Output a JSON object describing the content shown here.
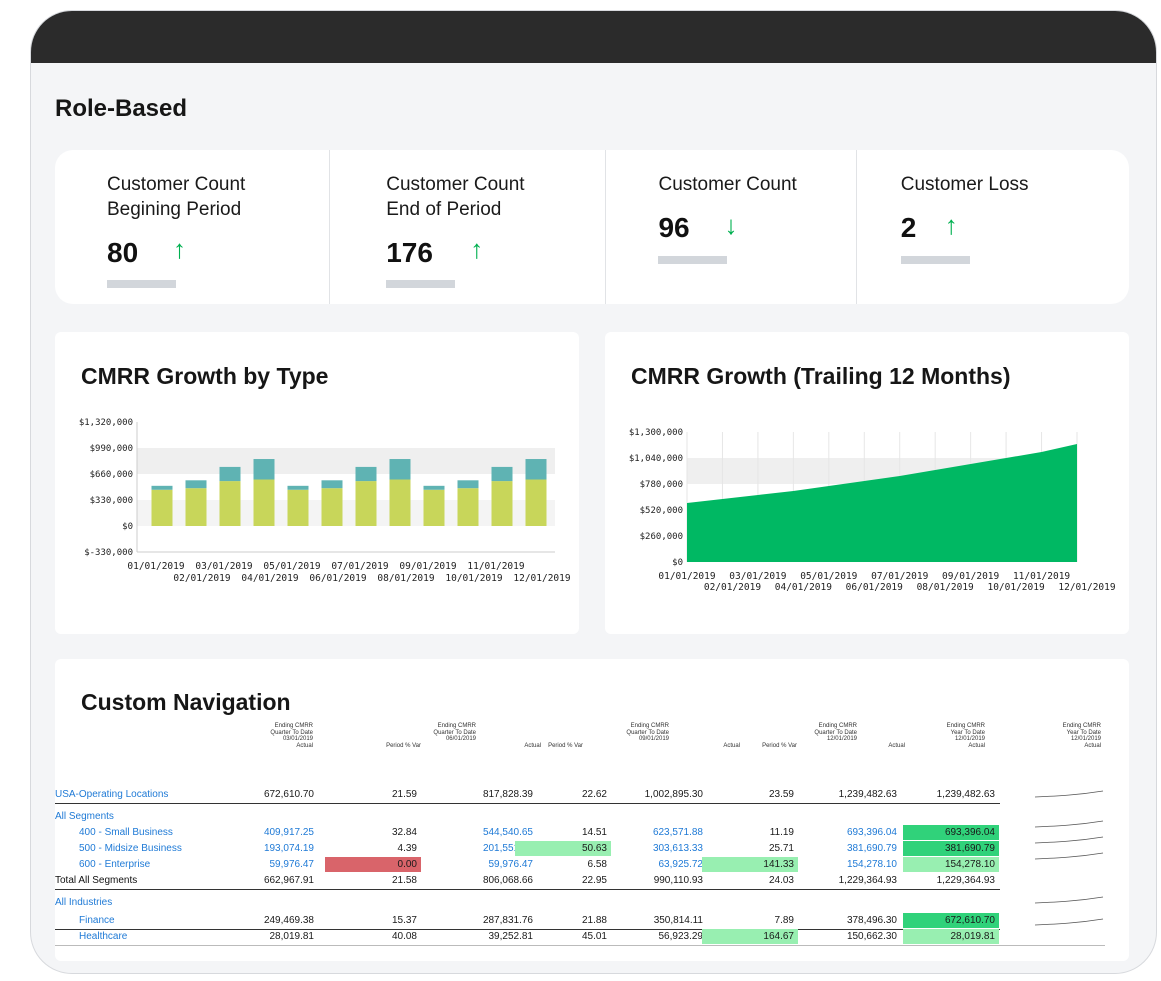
{
  "page": {
    "heading": "Role-Based"
  },
  "kpis": [
    {
      "label": "Customer Count\nBegining Period",
      "value": "80",
      "trend": "up",
      "arrow": "↑"
    },
    {
      "label": "Customer Count\nEnd of Period",
      "value": "176",
      "trend": "up",
      "arrow": "↑"
    },
    {
      "label": "Customer Count",
      "value": "96",
      "trend": "down",
      "arrow": "↓"
    },
    {
      "label": "Customer Loss",
      "value": "2",
      "trend": "up",
      "arrow": "↑"
    }
  ],
  "colors": {
    "up": "#00b050",
    "down": "#00b050",
    "bar_base": "#c8d65a",
    "bar_top": "#5fb3b3",
    "area": "#00b863",
    "red": "#d9646a",
    "green_strong": "#30d27a",
    "green_light": "#98efb1",
    "link": "#1f7ad6"
  },
  "chart_data": [
    {
      "type": "bar",
      "title": "CMRR Growth by Type",
      "categories": [
        "01/01/2019",
        "02/01/2019",
        "03/01/2019",
        "04/01/2019",
        "05/01/2019",
        "06/01/2019",
        "07/01/2019",
        "08/01/2019",
        "09/01/2019",
        "10/01/2019",
        "11/01/2019",
        "12/01/2019"
      ],
      "series": [
        {
          "values": [
            460000,
            480000,
            570000,
            590000,
            460000,
            480000,
            570000,
            590000,
            460000,
            480000,
            570000,
            590000
          ]
        },
        {
          "values": [
            50000,
            100000,
            180000,
            260000,
            50000,
            100000,
            180000,
            260000,
            50000,
            100000,
            180000,
            260000
          ]
        }
      ],
      "yticks": [
        "$1,320,000",
        "$990,000",
        "$660,000",
        "$330,000",
        "$0",
        "$-330,000"
      ],
      "ylim": [
        -330000,
        1320000
      ],
      "grid": true,
      "stacked": true
    },
    {
      "type": "area",
      "title": "CMRR Growth (Trailing 12 Months)",
      "x": [
        "01/01/2019",
        "02/01/2019",
        "03/01/2019",
        "04/01/2019",
        "05/01/2019",
        "06/01/2019",
        "07/01/2019",
        "08/01/2019",
        "09/01/2019",
        "10/01/2019",
        "11/01/2019",
        "12/01/2019"
      ],
      "values": [
        590000,
        630000,
        670000,
        710000,
        760000,
        810000,
        860000,
        920000,
        980000,
        1040000,
        1100000,
        1180000
      ],
      "yticks": [
        "$1,300,000",
        "$1,040,000",
        "$780,000",
        "$520,000",
        "$260,000",
        "$0"
      ],
      "ylim": [
        0,
        1300000
      ],
      "grid": true
    }
  ],
  "table": {
    "title": "Custom Navigation",
    "headers": [
      {
        "lines": [
          "Ending CMRR",
          "Quarter To Date",
          "03/01/2019",
          "Actual"
        ]
      },
      {
        "lines": [
          "Period % Var"
        ]
      },
      {
        "lines": [
          "Ending CMRR",
          "Quarter To Date",
          "06/01/2019"
        ]
      },
      {
        "lines": [
          "Actual"
        ]
      },
      {
        "lines": [
          "Period % Var"
        ]
      },
      {
        "lines": [
          "Ending CMRR",
          "Quarter To Date",
          "09/01/2019"
        ]
      },
      {
        "lines": [
          "Actual"
        ]
      },
      {
        "lines": [
          "Period % Var"
        ]
      },
      {
        "lines": [
          "Ending CMRR",
          "Quarter To Date",
          "12/01/2019"
        ]
      },
      {
        "lines": [
          "Actual"
        ]
      },
      {
        "lines": [
          "Ending CMRR",
          "Year To Date",
          "12/01/2019",
          "Actual"
        ]
      },
      {
        "lines": [
          "Ending CMRR",
          "Year To Date",
          "12/01/2019",
          "Actual"
        ]
      }
    ],
    "rows": [
      {
        "label": "USA-Operating Locations",
        "style": "link",
        "values": [
          "672,610.70",
          "21.59",
          "817,828.39",
          "22.62",
          "1,002,895.30",
          "23.59",
          "1,239,482.63",
          "1,239,482.63"
        ]
      },
      {
        "label": "All Segments",
        "style": "link",
        "values": []
      },
      {
        "label": "400 - Small Business",
        "style": "link",
        "indent": true,
        "values": [
          "409,917.25",
          "32.84",
          "544,540.65",
          "14.51",
          "623,571.88",
          "11.19",
          "693,396.04",
          "693,396.04"
        ],
        "links": [
          0,
          2,
          4,
          6
        ],
        "hl": {
          "7": "green_strong"
        }
      },
      {
        "label": "500 - Midsize Business",
        "style": "link",
        "indent": true,
        "values": [
          "193,074.19",
          "4.39",
          "201,551.54",
          "50.63",
          "303,613.33",
          "25.71",
          "381,690.79",
          "381,690.79"
        ],
        "links": [
          0,
          2,
          4,
          6
        ],
        "hl": {
          "3": "green_light",
          "7": "green_strong"
        }
      },
      {
        "label": "600 - Enterprise",
        "style": "link",
        "indent": true,
        "values": [
          "59,976.47",
          "0.00",
          "59,976.47",
          "6.58",
          "63,925.72",
          "141.33",
          "154,278.10",
          "154,278.10"
        ],
        "links": [
          0,
          2,
          4,
          6
        ],
        "hl": {
          "1": "red",
          "5": "green_light",
          "7": "green_light"
        }
      },
      {
        "label": "Total All Segments",
        "style": "plain",
        "values": [
          "662,967.91",
          "21.58",
          "806,068.66",
          "22.95",
          "990,110.93",
          "24.03",
          "1,229,364.93",
          "1,229,364.93"
        ]
      },
      {
        "label": "All Industries",
        "style": "link",
        "values": []
      },
      {
        "label": "Finance",
        "style": "link",
        "indent": true,
        "values": [
          "249,469.38",
          "15.37",
          "287,831.76",
          "21.88",
          "350,814.11",
          "7.89",
          "378,496.30",
          "672,610.70"
        ],
        "hl": {
          "7": "green_strong"
        }
      },
      {
        "label": "Healthcare",
        "style": "link",
        "indent": true,
        "values": [
          "28,019.81",
          "40.08",
          "39,252.81",
          "45.01",
          "56,923.29",
          "164.67",
          "150,662.30",
          "28,019.81"
        ],
        "hl": {
          "5": "green_light",
          "7": "green_light"
        }
      }
    ]
  }
}
